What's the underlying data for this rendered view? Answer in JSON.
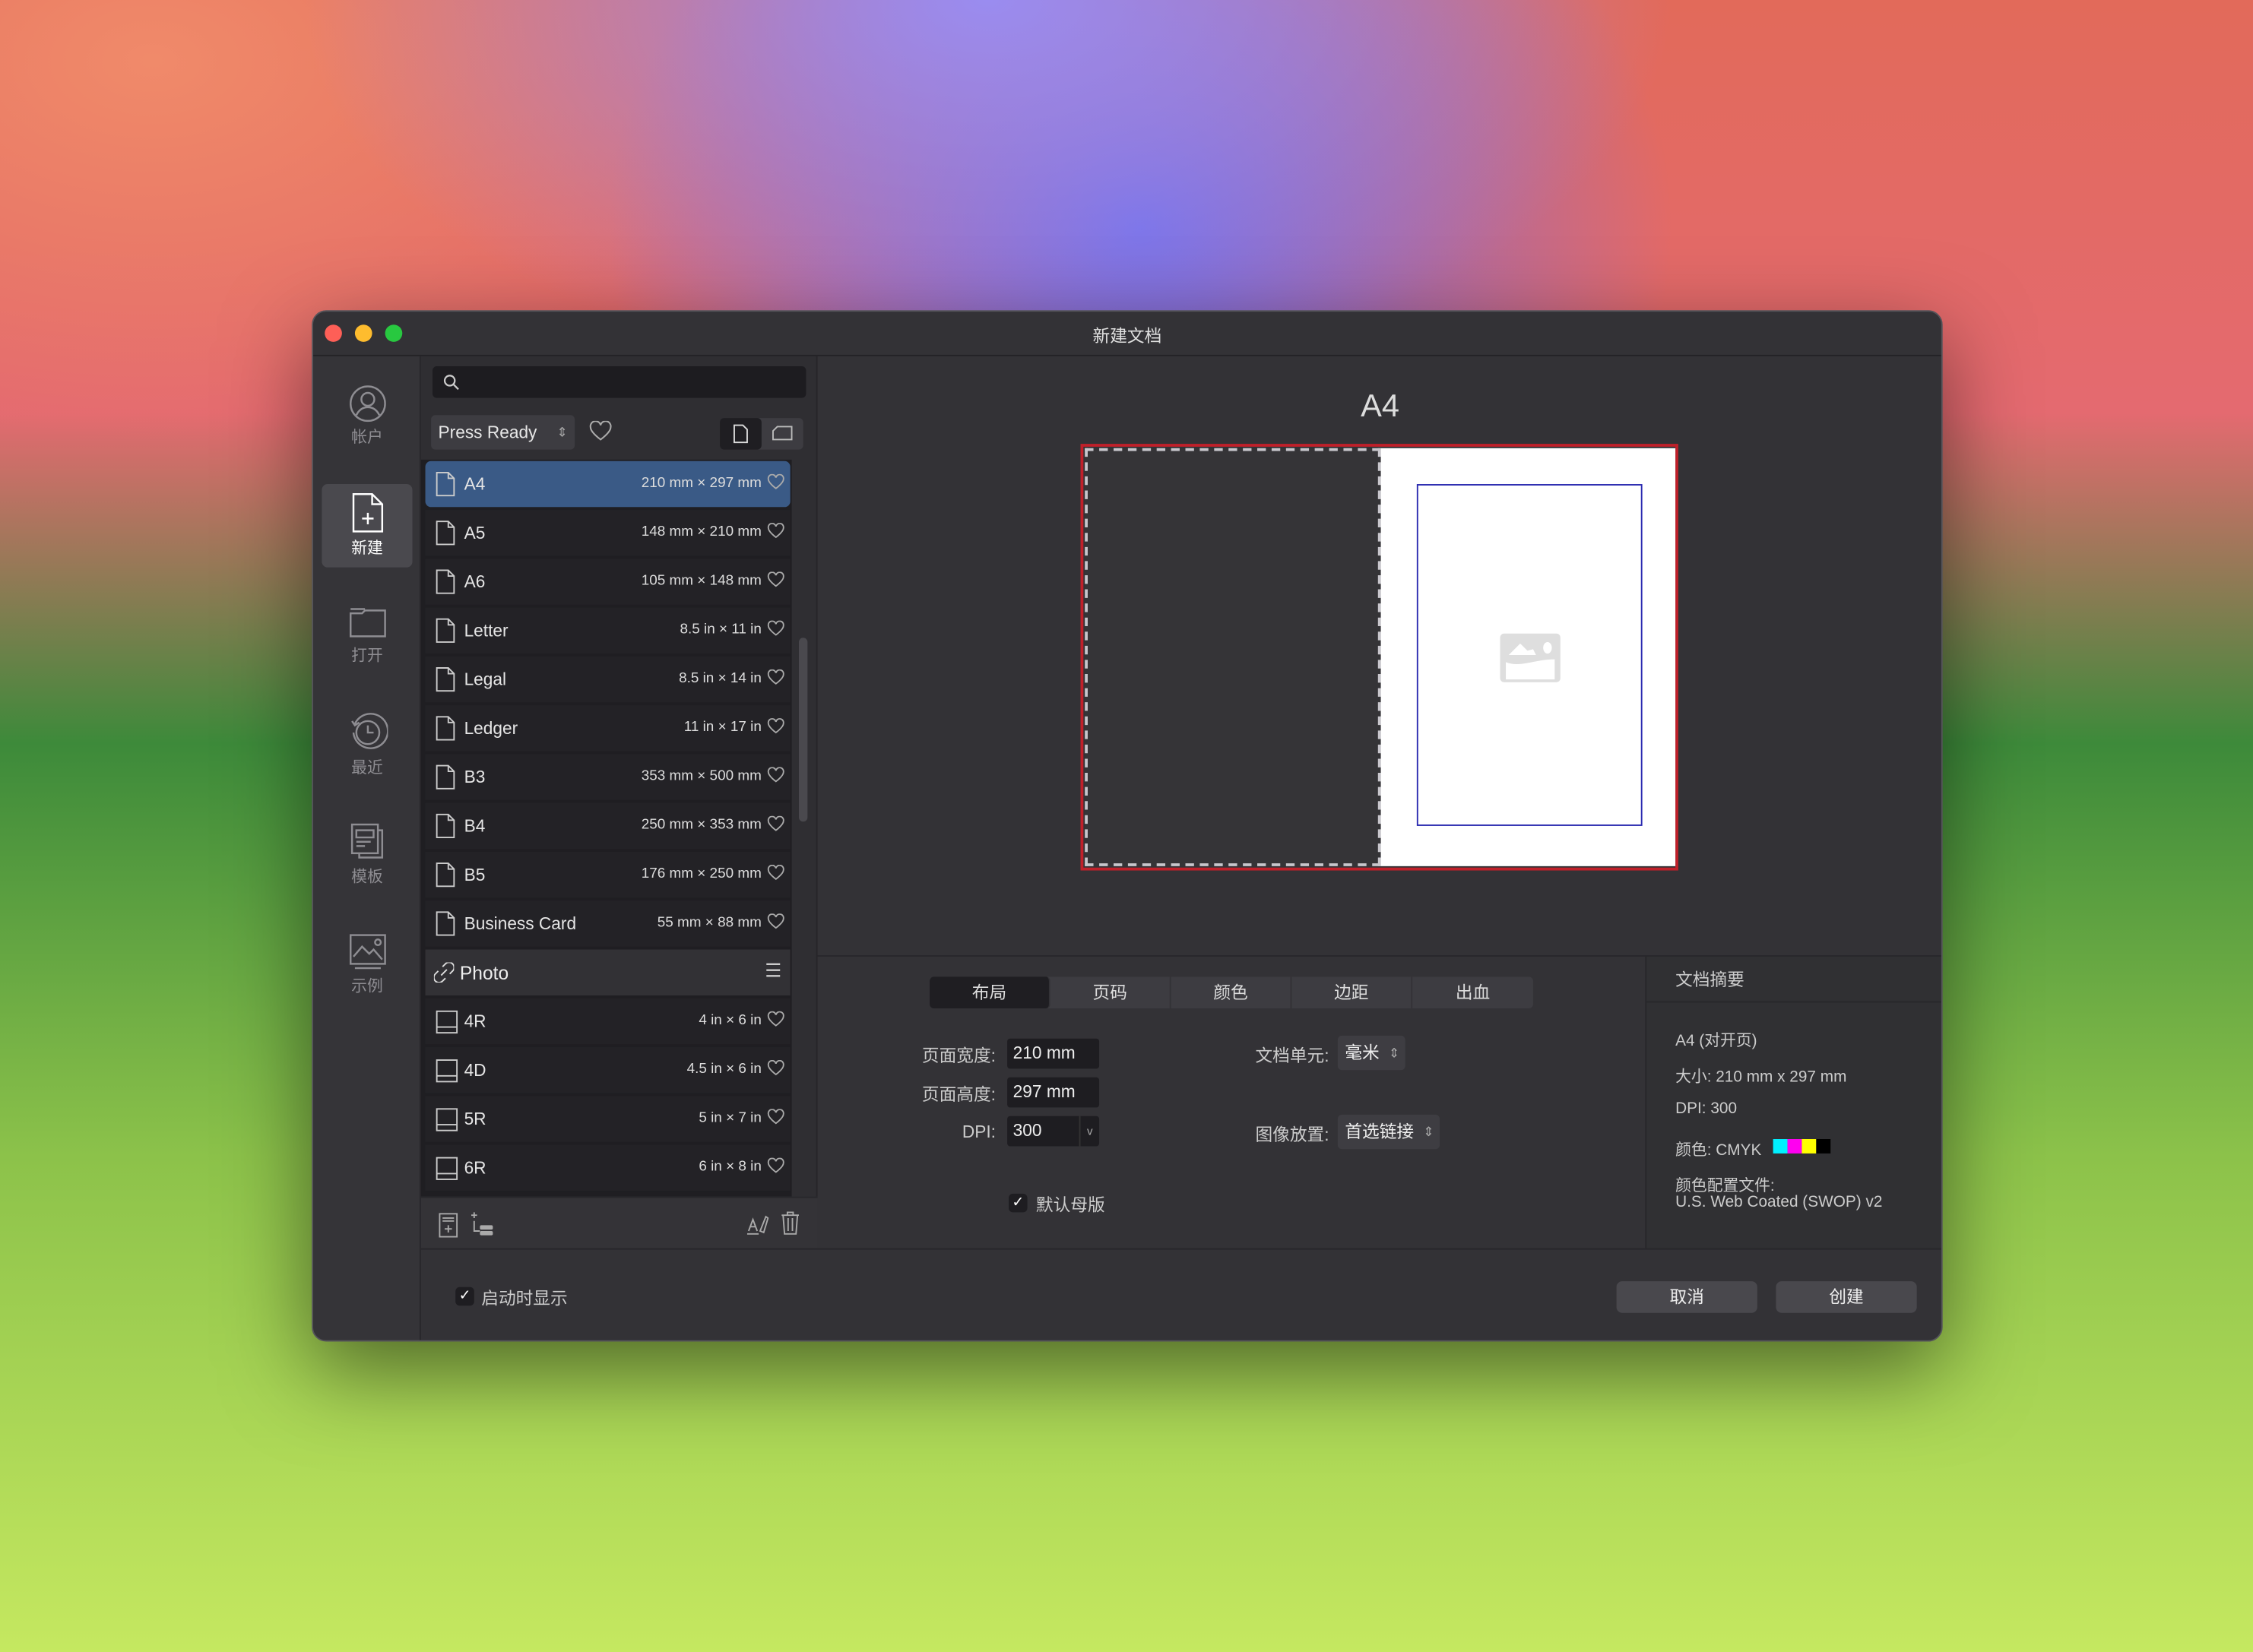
{
  "window": {
    "title": "新建文档"
  },
  "sidebar": {
    "items": [
      {
        "label": "帐户",
        "icon": "account-icon"
      },
      {
        "label": "新建",
        "icon": "new-document-icon",
        "active": true
      },
      {
        "label": "打开",
        "icon": "folder-open-icon"
      },
      {
        "label": "最近",
        "icon": "recent-clock-icon"
      },
      {
        "label": "模板",
        "icon": "templates-icon"
      },
      {
        "label": "示例",
        "icon": "samples-image-icon"
      }
    ]
  },
  "presets": {
    "search_placeholder": "",
    "category": "Press Ready",
    "items": [
      {
        "name": "A4",
        "size": "210 mm × 297 mm",
        "selected": true
      },
      {
        "name": "A5",
        "size": "148 mm × 210 mm"
      },
      {
        "name": "A6",
        "size": "105 mm × 148 mm"
      },
      {
        "name": "Letter",
        "size": "8.5 in × 11 in"
      },
      {
        "name": "Legal",
        "size": "8.5 in × 14 in"
      },
      {
        "name": "Ledger",
        "size": "11 in × 17 in"
      },
      {
        "name": "B3",
        "size": "353 mm × 500 mm"
      },
      {
        "name": "B4",
        "size": "250 mm × 353 mm"
      },
      {
        "name": "B5",
        "size": "176 mm × 250 mm"
      },
      {
        "name": "Business Card",
        "size": "55 mm × 88 mm"
      }
    ],
    "group": "Photo",
    "photo_items": [
      {
        "name": "4R",
        "size": "4 in × 6 in"
      },
      {
        "name": "4D",
        "size": "4.5 in × 6 in"
      },
      {
        "name": "5R",
        "size": "5 in × 7 in"
      },
      {
        "name": "6R",
        "size": "6 in × 8 in"
      }
    ]
  },
  "preview": {
    "title": "A4",
    "bleed_color": "#c0202a",
    "margin_color": "#2a2ab0"
  },
  "tabs": [
    "布局",
    "页码",
    "颜色",
    "边距",
    "出血"
  ],
  "layout": {
    "width_label": "页面宽度:",
    "width_value": "210 mm",
    "height_label": "页面高度:",
    "height_value": "297 mm",
    "dpi_label": "DPI:",
    "dpi_value": "300",
    "unit_label": "文档单元:",
    "unit_value": "毫米",
    "placement_label": "图像放置:",
    "placement_value": "首选链接",
    "default_master_label": "默认母版",
    "default_master_checked": true
  },
  "summary": {
    "title": "文档摘要",
    "line1": "A4 (对开页)",
    "line2": "大小: 210 mm x 297 mm",
    "line3": "DPI:  300",
    "line4": "颜色: CMYK",
    "cmyk_colors": [
      "#00f0ff",
      "#ff00f0",
      "#ffff00",
      "#000000"
    ],
    "line5": "颜色配置文件:",
    "line6": "U.S. Web Coated (SWOP) v2"
  },
  "footer": {
    "show_on_startup": "启动时显示",
    "show_on_startup_checked": true,
    "cancel": "取消",
    "create": "创建"
  }
}
